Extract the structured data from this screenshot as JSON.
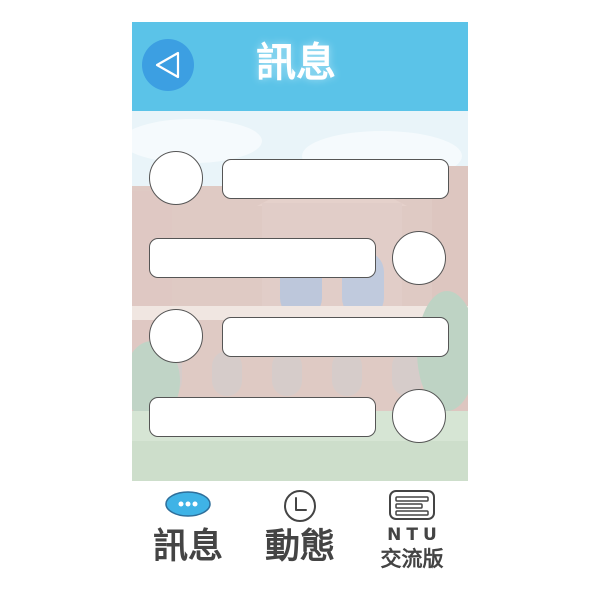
{
  "header": {
    "title": "訊息",
    "back_icon": "back-triangle-icon",
    "background_color": "#5bc3e8",
    "back_button_color": "#3c9fe2"
  },
  "messages": [
    {
      "side": "left",
      "text": ""
    },
    {
      "side": "right",
      "text": ""
    },
    {
      "side": "left",
      "text": ""
    },
    {
      "side": "right",
      "text": ""
    }
  ],
  "tabbar": {
    "tabs": [
      {
        "label": "訊息",
        "icon": "chat-bubble-icon",
        "active": true
      },
      {
        "label": "動態",
        "icon": "clock-icon",
        "active": false
      },
      {
        "label_top": "NTU",
        "label_bottom": "交流版",
        "icon": "board-icon",
        "active": false
      }
    ]
  }
}
